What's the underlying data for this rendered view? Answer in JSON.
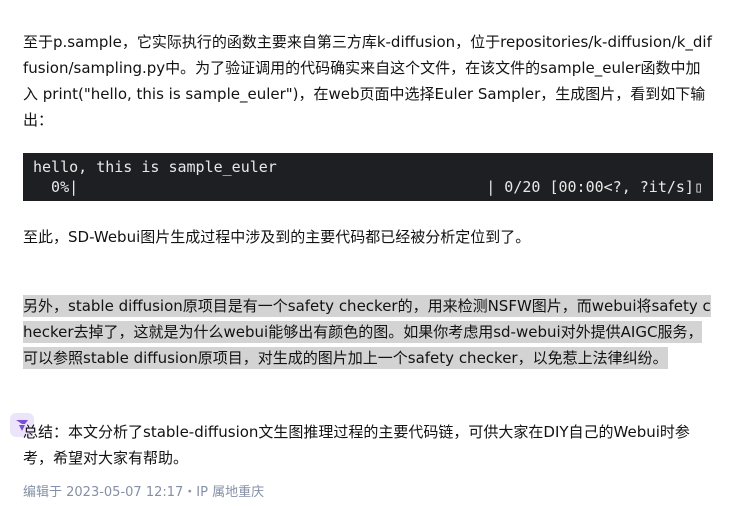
{
  "article": {
    "paragraph1": "至于p.sample，它实际执行的函数主要来自第三方库k-diffusion，位于repositories/k-diffusion/k_diffusion/sampling.py中。为了验证调用的代码确实来自这个文件，在该文件的sample_euler函数中加入 print(\"hello, this is sample_euler\")，在web页面中选择Euler Sampler，生成图片，看到如下输出：",
    "code": {
      "line1": "hello, this is sample_euler",
      "line2_left": "  0%|",
      "line2_right": "| 0/20 [00:00<?, ?it/s]▯"
    },
    "paragraph2": "至此，SD-Webui图片生成过程中涉及到的主要代码都已经被分析定位到了。",
    "paragraph3": "另外，stable diffusion原项目是有一个safety checker的，用来检测NSFW图片，而webui将safety checker去掉了，这就是为什么webui能够出有颜色的图。如果你考虑用sd-webui对外提供AIGC服务，可以参照stable diffusion原项目，对生成的图片加上一个safety checker，以免惹上法律纠纷。",
    "paragraph4": "总结：本文分析了stable-diffusion文生图推理过程的主要代码链，可供大家在DIY自己的Webui时参考，希望对大家有帮助。"
  },
  "meta": {
    "edited": "编辑于 2023-05-07 12:17・IP 属地重庆"
  },
  "colors": {
    "highlight": "#d3d3d3",
    "code_bg": "#1e1f22",
    "meta_text": "#8590a6",
    "float_icon": "#7b4fd6"
  },
  "icons": {
    "floating_button": "purple-assistant-icon"
  }
}
